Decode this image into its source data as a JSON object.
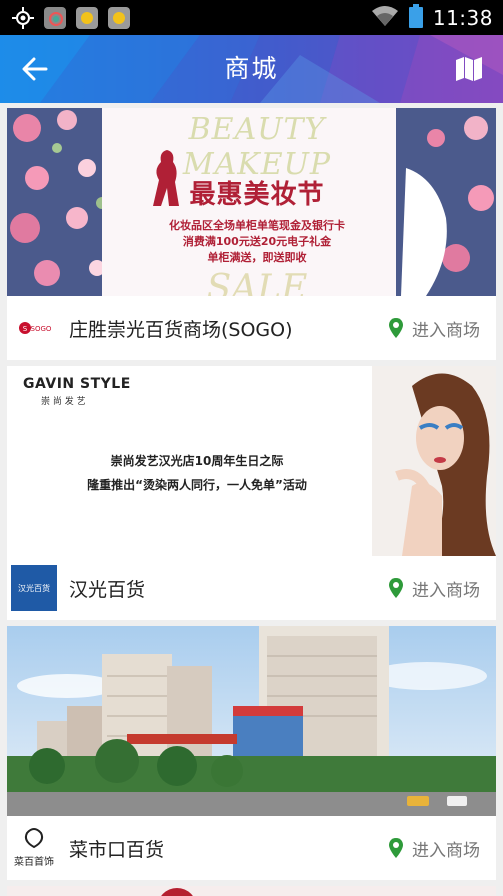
{
  "status_bar": {
    "time": "11:38"
  },
  "header": {
    "title": "商城"
  },
  "stores": [
    {
      "name": "庄胜崇光百货商场(SOGO)",
      "enter_label": "进入商场",
      "logo_text": "SOGO",
      "banner": {
        "top_text": "BEAUTY MAKEUP",
        "headline": "最惠美妆节",
        "line1": "化妆品区全场单柜单笔现金及银行卡",
        "line2": "消费满100元送20元电子礼金",
        "line3": "单柜满送，即送即收",
        "bottom_text": "SALE"
      }
    },
    {
      "name": "汉光百货",
      "enter_label": "进入商场",
      "logo_text": "汉光百货",
      "banner": {
        "brand": "GAVIN STYLE",
        "brand_sub": "崇 尚 发 艺",
        "line1": "崇尚发艺汉光店10周年生日之际",
        "line2": "隆重推出“烫染两人同行，一人免单”活动"
      }
    },
    {
      "name": "菜市口百货",
      "enter_label": "进入商场",
      "logo_text": "菜百首饰"
    }
  ],
  "colors": {
    "appbar_start": "#1d86e6",
    "appbar_end": "#7a49c2",
    "pin_green": "#2e9a3a",
    "headline_red": "#b02036"
  }
}
